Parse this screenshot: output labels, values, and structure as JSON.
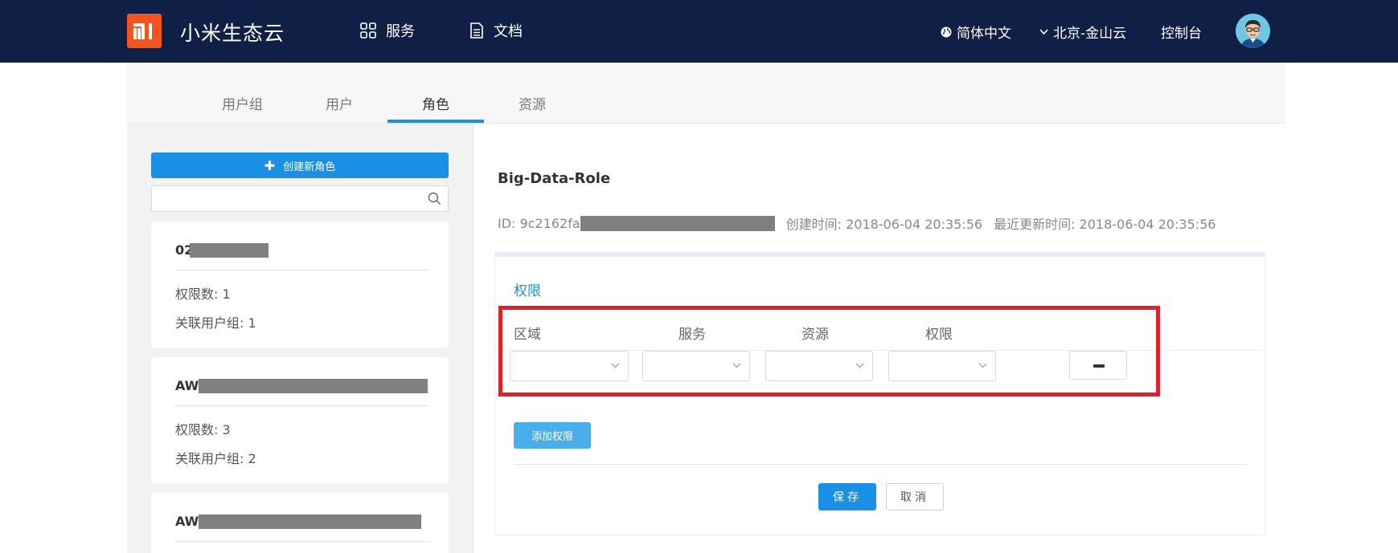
{
  "header": {
    "brand": "小米生态云",
    "nav": [
      {
        "label": "服务",
        "icon": "grid-icon"
      },
      {
        "label": "文档",
        "icon": "document-icon"
      }
    ],
    "language": "简体中文",
    "region": "北京-金山云",
    "console": "控制台"
  },
  "tabs": [
    "用户组",
    "用户",
    "角色",
    "资源"
  ],
  "active_tab": "角色",
  "sidebar": {
    "create_button": "创建新角色",
    "search_placeholder": "",
    "cards": [
      {
        "title_prefix": "02",
        "lines": [
          "权限数: 1",
          "关联用户组: 1"
        ]
      },
      {
        "title_prefix": "AW",
        "lines": [
          "权限数: 3",
          "关联用户组: 2"
        ]
      },
      {
        "title_prefix": "AW",
        "lines": []
      }
    ]
  },
  "detail": {
    "role_name": "Big-Data-Role",
    "id_prefix": "ID: 9c2162fa",
    "created": "创建时间: 2018-06-04 20:35:56",
    "updated": "最近更新时间: 2018-06-04 20:35:56",
    "permissions": {
      "title": "权限",
      "columns": [
        "区域",
        "服务",
        "资源",
        "权限"
      ],
      "add_button": "添加权限",
      "save_button": "保存",
      "cancel_button": "取消"
    }
  },
  "colors": {
    "topbar": "#0f1f45",
    "accent": "#1a8fe3",
    "logo": "#f5541f",
    "highlight": "#e2202b"
  }
}
